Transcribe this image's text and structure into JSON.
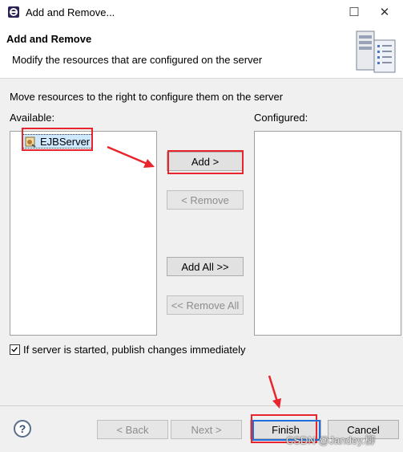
{
  "window": {
    "title": "Add and Remove...",
    "maximize_glyph": "☐",
    "close_glyph": "✕"
  },
  "header": {
    "title": "Add and Remove",
    "description": "Modify the resources that are configured on the server"
  },
  "instructions": "Move resources to the right to configure them on the server",
  "available": {
    "label": "Available:",
    "items": [
      {
        "label": "EJBServer",
        "icon": "project-icon",
        "selected": true
      }
    ]
  },
  "configured": {
    "label": "Configured:",
    "items": []
  },
  "buttons": {
    "add": "Add >",
    "remove": "< Remove",
    "add_all": "Add All >>",
    "remove_all": "<< Remove All"
  },
  "publish_option": {
    "label": "If server is started, publish changes immediately",
    "checked": true
  },
  "footer": {
    "help": "?",
    "back": "< Back",
    "next": "Next >",
    "finish": "Finish",
    "cancel": "Cancel"
  },
  "watermark": "CSDN @Jandey.柳",
  "colors": {
    "annotation_red": "#e8252d",
    "annotation_blue": "#1e6fd9",
    "selection": "#cde8ff"
  }
}
